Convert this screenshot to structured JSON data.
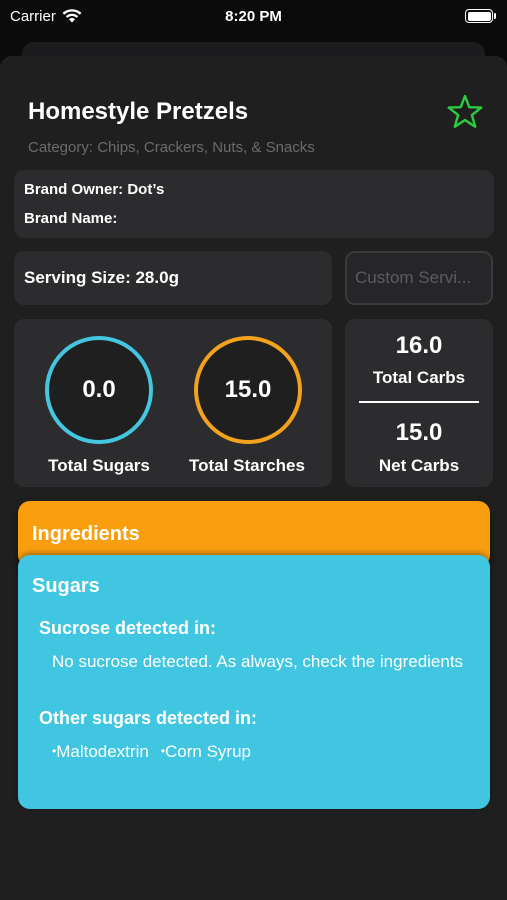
{
  "status_bar": {
    "carrier": "Carrier",
    "time": "8:20 PM"
  },
  "product": {
    "title": "Homestyle Pretzels",
    "category": "Category: Chips, Crackers, Nuts, & Snacks",
    "brand_owner": "Brand Owner: Dot’s",
    "brand_name": "Brand Name:",
    "serving_size": "Serving Size:  28.0g",
    "custom_serving_placeholder": "Custom Servi..."
  },
  "nutrition": {
    "total_sugars_value": "0.0",
    "total_sugars_label": "Total Sugars",
    "total_starches_value": "15.0",
    "total_starches_label": "Total Starches",
    "total_carbs_value": "16.0",
    "total_carbs_label": "Total Carbs",
    "net_carbs_value": "15.0",
    "net_carbs_label": "Net Carbs"
  },
  "ingredients": {
    "title": "Ingredients"
  },
  "sugars": {
    "title": "Sugars",
    "sucrose_heading": "Sucrose detected in:",
    "sucrose_text": "No sucrose detected. As always, check the ingredients",
    "other_heading": "Other sugars detected in:",
    "other_items": [
      "Maltodextrin",
      "Corn Syrup"
    ]
  },
  "colors": {
    "sugar_ring": "#45c6e0",
    "starch_ring": "#f2a21d",
    "ingredients_bg": "#f99f0f",
    "sugars_bg": "#40c6e0",
    "favorite_star": "#2ecc40"
  },
  "icons": {
    "wifi": "wifi-icon",
    "battery": "battery-icon",
    "favorite": "star-icon"
  }
}
